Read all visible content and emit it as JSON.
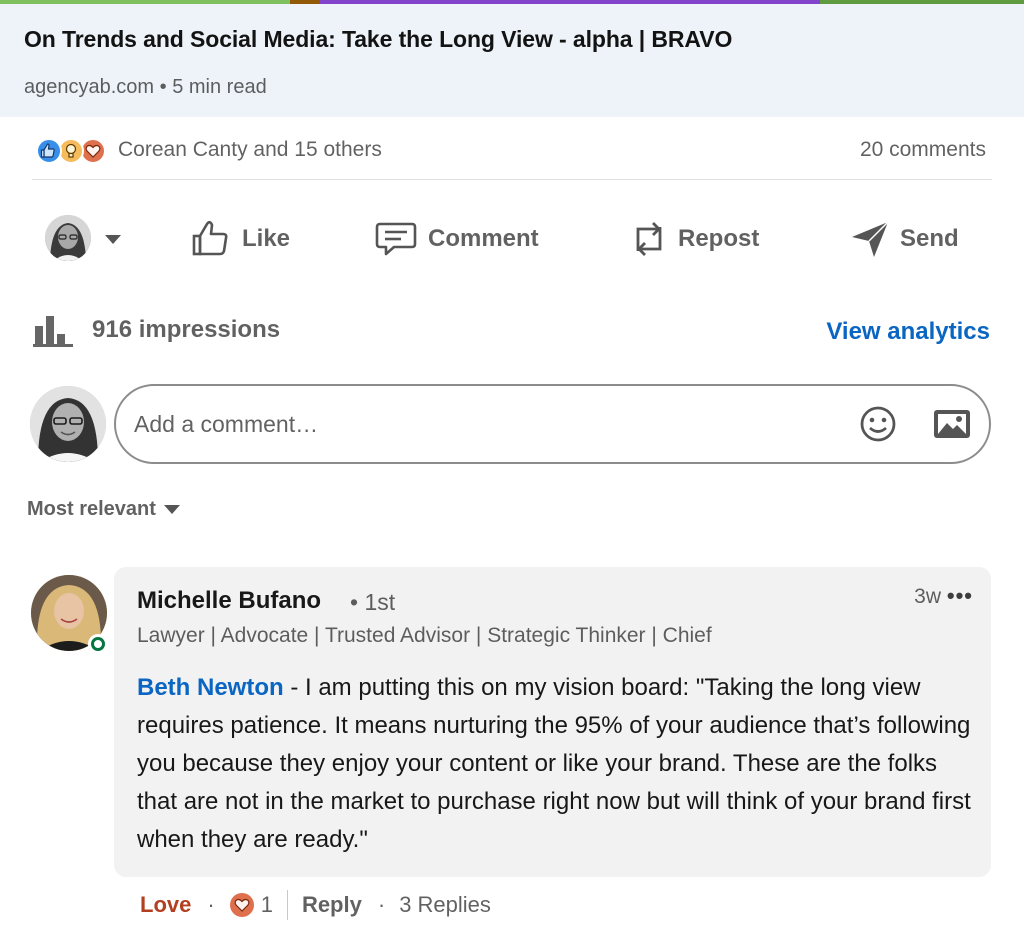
{
  "colors": {
    "link_blue": "#0a66c2",
    "love_red": "#b24020",
    "card_bg": "#edf3f8",
    "bubble_bg": "#f2f2f2",
    "online_green": "#057642",
    "strip": [
      "#7fc15e",
      "#915907",
      "#8344cc",
      "#5f9b41"
    ]
  },
  "link_card": {
    "title": "On Trends and Social Media: Take the Long View - alpha | BRAVO",
    "source": "agencyab.com • 5 min read"
  },
  "reactions": {
    "icons": [
      "like-icon",
      "insightful-icon",
      "love-icon"
    ],
    "summary": "Corean Canty and 15 others",
    "comments_count": "20 comments"
  },
  "actions": {
    "actor_icon": "avatar",
    "like": "Like",
    "comment": "Comment",
    "repost": "Repost",
    "send": "Send"
  },
  "analytics": {
    "impressions": "916 impressions",
    "view_link": "View analytics"
  },
  "composer": {
    "placeholder": "Add a comment…",
    "emoji_icon": "smiley-icon",
    "image_icon": "image-icon"
  },
  "sort": {
    "label": "Most relevant"
  },
  "comment": {
    "author": "Michelle Bufano",
    "degree": "• 1st",
    "headline": "Lawyer | Advocate | Trusted Advisor | Strategic Thinker | Chief",
    "time": "3w",
    "more": "•••",
    "mention": "Beth Newton",
    "text": " - I am putting this on my vision board: \"Taking the long view requires patience. It means nurturing the 95% of your audience that’s following you because they enjoy your content or like your brand. These are the folks that are not in the market to purchase right now but will think of your brand first when they are ready.\"",
    "reaction_label": "Love",
    "separator": "·",
    "reaction_count": "1",
    "reply_label": "Reply",
    "replies": "3 Replies"
  }
}
